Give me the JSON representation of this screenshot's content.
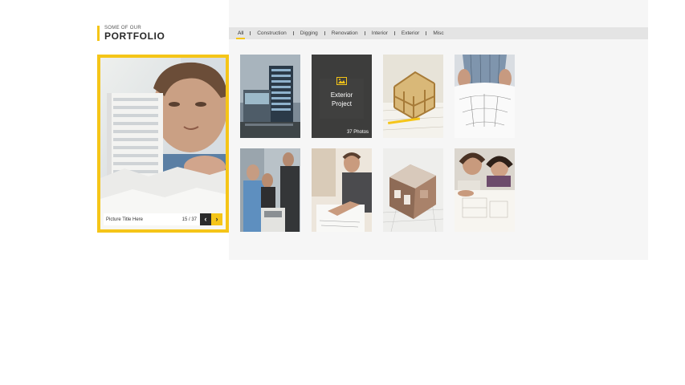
{
  "section": {
    "subtitle": "SOME OF OUR",
    "title": "PORTFOLIO"
  },
  "featured": {
    "picture_title": "Picture Title Here",
    "counter": "15 / 37",
    "prev_glyph": "‹",
    "next_glyph": "›"
  },
  "filters": [
    "All",
    "Construction",
    "Digging",
    "Renovation",
    "Interior",
    "Exterior",
    "Misc"
  ],
  "active_filter": "All",
  "hover_tile": {
    "title_line1": "Exterior",
    "title_line2": "Project",
    "count": "37 Photos",
    "icon": "image-icon"
  },
  "colors": {
    "accent": "#f5c518",
    "dark": "#2b2b2b",
    "panel": "#f6f6f6",
    "filter_bar": "#e4e4e4"
  }
}
